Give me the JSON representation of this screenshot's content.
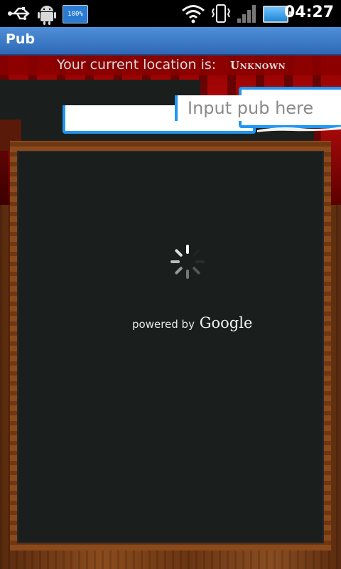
{
  "status_bar": {
    "battery_app_label": "100%",
    "time": "04:27",
    "icons": [
      "usb-icon",
      "android-icon",
      "battery-app-icon",
      "wifi-icon",
      "vibrate-icon",
      "signal-icon",
      "battery-icon"
    ]
  },
  "title_bar": {
    "title": "Pub"
  },
  "location": {
    "label": "Your current location is:",
    "value": "Unknown"
  },
  "search": {
    "placeholder": "Input pub here",
    "value": ""
  },
  "footer": {
    "powered_prefix": "powered by",
    "powered_brand": "Google"
  },
  "colors": {
    "accent": "#2196f3",
    "title_bar": "#3f7cc8",
    "board": "#1a1e1d",
    "red_band": "#a50808",
    "wood": "#7a4018"
  }
}
